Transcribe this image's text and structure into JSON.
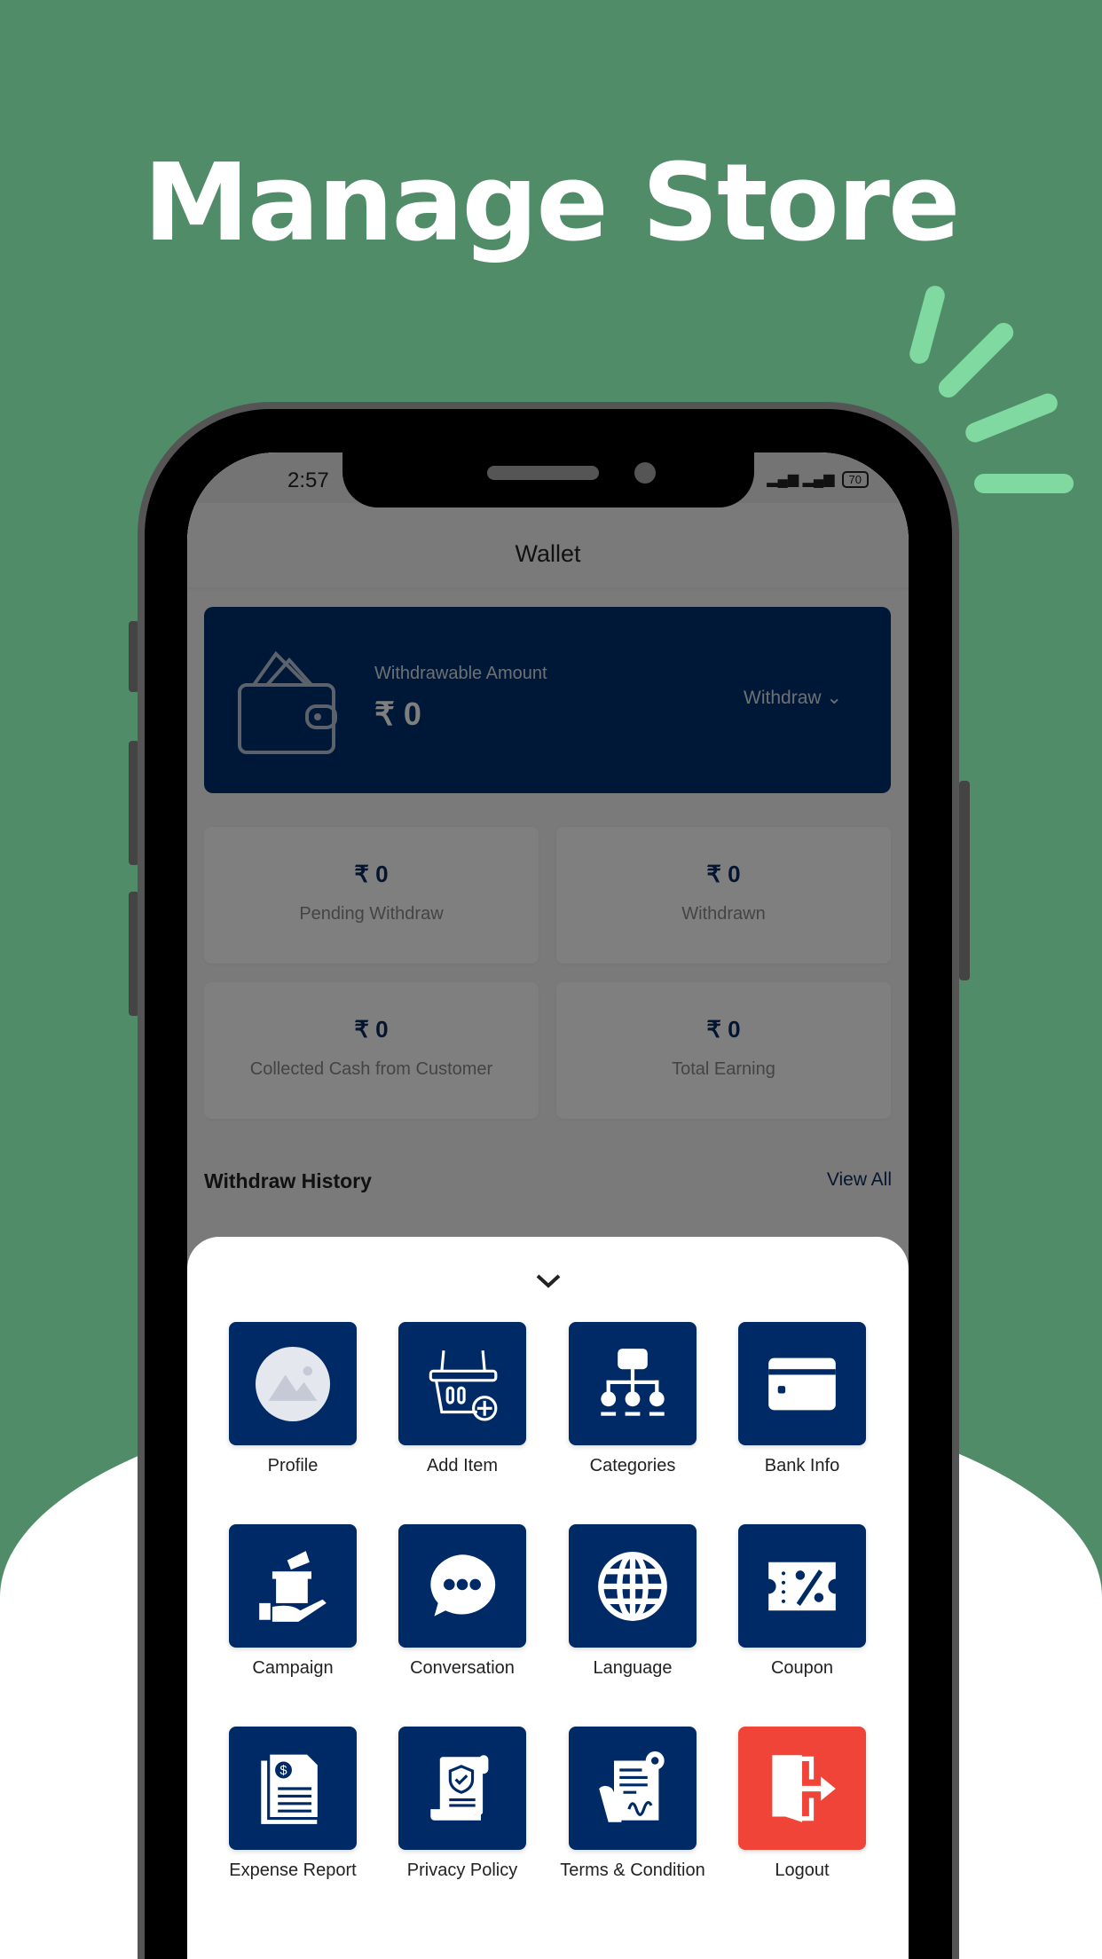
{
  "headline": "Manage Store",
  "status_bar": {
    "time": "2:57",
    "battery": "70"
  },
  "header": {
    "title": "Wallet"
  },
  "balance_card": {
    "label": "Withdrawable Amount",
    "amount": "₹ 0",
    "withdraw_label": "Withdraw"
  },
  "stats": [
    {
      "value": "₹ 0",
      "label": "Pending Withdraw"
    },
    {
      "value": "₹ 0",
      "label": "Withdrawn"
    },
    {
      "value": "₹ 0",
      "label": "Collected Cash from Customer"
    },
    {
      "value": "₹ 0",
      "label": "Total Earning"
    }
  ],
  "history": {
    "title": "Withdraw History",
    "view_all": "View All"
  },
  "menu": [
    {
      "label": "Profile",
      "icon": "image-placeholder-icon"
    },
    {
      "label": "Add Item",
      "icon": "basket-add-icon"
    },
    {
      "label": "Categories",
      "icon": "hierarchy-icon"
    },
    {
      "label": "Bank Info",
      "icon": "credit-card-icon"
    },
    {
      "label": "Campaign",
      "icon": "megaphone-gift-icon"
    },
    {
      "label": "Conversation",
      "icon": "chat-bubble-icon"
    },
    {
      "label": "Language",
      "icon": "globe-icon"
    },
    {
      "label": "Coupon",
      "icon": "coupon-icon"
    },
    {
      "label": "Expense Report",
      "icon": "invoice-icon"
    },
    {
      "label": "Privacy Policy",
      "icon": "shield-document-icon"
    },
    {
      "label": "Terms & Condition",
      "icon": "contract-icon"
    },
    {
      "label": "Logout",
      "icon": "logout-icon"
    }
  ],
  "colors": {
    "background": "#518c69",
    "tile": "#002a66",
    "logout": "#f04438",
    "accent_sparks": "#7fd9a0"
  }
}
